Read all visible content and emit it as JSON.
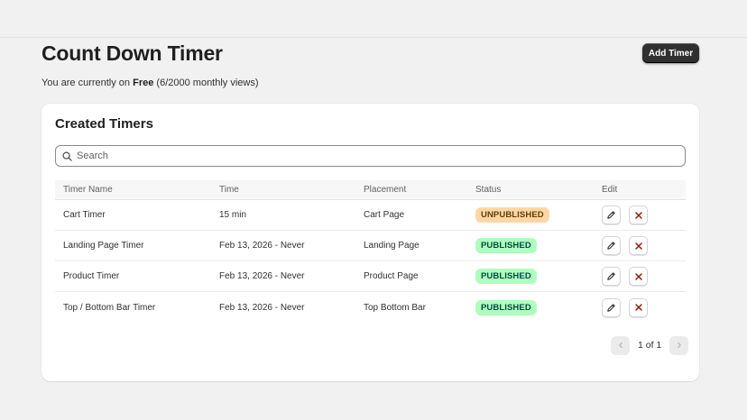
{
  "header": {
    "title": "Count Down Timer",
    "add_button_label": "Add Timer",
    "plan_prefix": "You are currently on",
    "plan_name": "Free",
    "plan_usage": "(6/2000 monthly views)"
  },
  "card": {
    "title": "Created Timers",
    "search_placeholder": "Search",
    "search_value": ""
  },
  "table": {
    "columns": [
      "Timer Name",
      "Time",
      "Placement",
      "Status",
      "Edit"
    ],
    "rows": [
      {
        "name": "Cart Timer",
        "time": "15 min",
        "placement": "Cart Page",
        "status": "UNPUBLISHED"
      },
      {
        "name": "Landing Page Timer",
        "time": "Feb 13, 2026 - Never",
        "placement": "Landing Page",
        "status": "PUBLISHED"
      },
      {
        "name": "Product Timer",
        "time": "Feb 13, 2026 - Never",
        "placement": "Product Page",
        "status": "PUBLISHED"
      },
      {
        "name": "Top / Bottom Bar Timer",
        "time": "Feb 13, 2026 - Never",
        "placement": "Top Bottom Bar",
        "status": "PUBLISHED"
      }
    ]
  },
  "pagination": {
    "label": "1 of 1"
  },
  "colors": {
    "unpublished_bg": "#ffd6a4",
    "published_bg": "#affebf",
    "delete_icon": "#8e1f0b",
    "primary_button": "#303030"
  },
  "icons": {
    "search": "search-icon",
    "edit": "pencil-icon",
    "delete": "close-icon",
    "prev": "chevron-left-icon",
    "next": "chevron-right-icon"
  }
}
